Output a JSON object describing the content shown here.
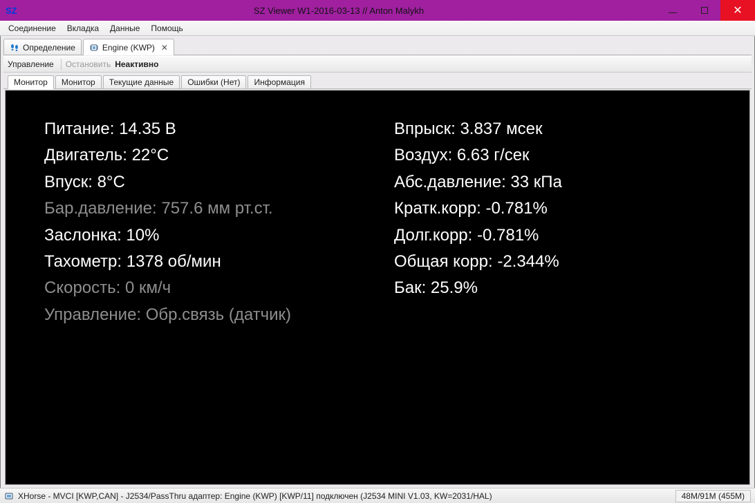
{
  "window": {
    "app_icon_text": "SZ",
    "title": "SZ Viewer W1-2016-03-13 // Anton Malykh"
  },
  "menu": {
    "items": [
      "Соединение",
      "Вкладка",
      "Данные",
      "Помощь"
    ]
  },
  "module_tabs": {
    "items": [
      {
        "label": "Определение",
        "closable": false,
        "icon": "footprints"
      },
      {
        "label": "Engine (KWP)",
        "closable": true,
        "icon": "chip"
      }
    ],
    "active_index": 1
  },
  "toolbar": {
    "label": "Управление",
    "stop": "Остановить",
    "state": "Неактивно"
  },
  "subtabs": {
    "items": [
      "Монитор",
      "Монитор",
      "Текущие данные",
      "Ошибки (Нет)",
      "Информация"
    ],
    "active_index": 0
  },
  "monitor": {
    "left": [
      {
        "label": "Питание",
        "value": "14.35 В",
        "dim": false
      },
      {
        "label": "Двигатель",
        "value": "22°C",
        "dim": false
      },
      {
        "label": "Впуск",
        "value": "8°C",
        "dim": false
      },
      {
        "label": "Бар.давление",
        "value": "757.6 мм рт.ст.",
        "dim": true
      },
      {
        "label": "Заслонка",
        "value": "10%",
        "dim": false
      },
      {
        "label": "Тахометр",
        "value": "1378 об/мин",
        "dim": false
      },
      {
        "label": "Скорость",
        "value": "0 км/ч",
        "dim": true
      },
      {
        "label": "Управление",
        "value": "Обр.связь (датчик)",
        "dim": true
      }
    ],
    "right": [
      {
        "label": "Впрыск",
        "value": "3.837 мсек",
        "dim": false
      },
      {
        "label": "Воздух",
        "value": "6.63 г/сек",
        "dim": false
      },
      {
        "label": "Абс.давление",
        "value": "33 кПа",
        "dim": false
      },
      {
        "label": "Кратк.корр",
        "value": "-0.781%",
        "dim": false
      },
      {
        "label": "Долг.корр",
        "value": "-0.781%",
        "dim": false
      },
      {
        "label": "Общая корр",
        "value": "-2.344%",
        "dim": false
      },
      {
        "label": "Бак",
        "value": "25.9%",
        "dim": false
      }
    ]
  },
  "status": {
    "text": "XHorse - MVCI [KWP,CAN] - J2534/PassThru адаптер: Engine (KWP) [KWP/11] подключен (J2534 MINI V1.03, KW=2031/HAL)",
    "memory": "48M/91M (455M)"
  }
}
